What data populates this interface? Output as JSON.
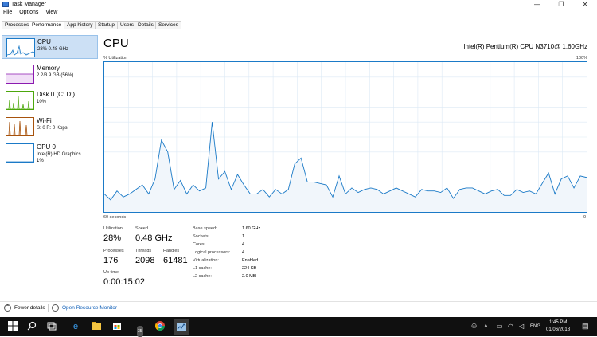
{
  "window": {
    "title": "Task Manager",
    "minimize": "—",
    "maximize": "❐",
    "close": "✕"
  },
  "menu": [
    "File",
    "Options",
    "View"
  ],
  "tabs": [
    "Processes",
    "Performance",
    "App history",
    "Startup",
    "Users",
    "Details",
    "Services"
  ],
  "active_tab": "Performance",
  "sidebar": [
    {
      "name": "CPU",
      "sub": "28%  0.48 GHz",
      "sub2": "",
      "color": "#1b7ac7"
    },
    {
      "name": "Memory",
      "sub": "2.2/3.9 GB (56%)",
      "sub2": "",
      "color": "#8b1ab0"
    },
    {
      "name": "Disk 0 (C: D:)",
      "sub": "10%",
      "sub2": "",
      "color": "#4ca70c"
    },
    {
      "name": "Wi-Fi",
      "sub": "S: 0  R: 0 Kbps",
      "sub2": "",
      "color": "#a7520c"
    },
    {
      "name": "GPU 0",
      "sub": "Intel(R) HD Graphics",
      "sub2": "1%",
      "color": "#1b7ac7"
    }
  ],
  "main": {
    "title": "CPU",
    "model": "Intel(R) Pentium(R) CPU N3710@ 1.60GHz",
    "util_label": "% Utilization",
    "max_label": "100%",
    "time_label": "60 seconds",
    "min_label": "0"
  },
  "stats": {
    "utilization_label": "Utilization",
    "utilization": "28%",
    "speed_label": "Speed",
    "speed": "0.48 GHz",
    "processes_label": "Processes",
    "processes": "176",
    "threads_label": "Threads",
    "threads": "2098",
    "handles_label": "Handles",
    "handles": "61481",
    "uptime_label": "Up time",
    "uptime": "0:00:15:02"
  },
  "specs": [
    {
      "k": "Base speed:",
      "v": "1.60 GHz"
    },
    {
      "k": "Sockets:",
      "v": "1"
    },
    {
      "k": "Cores:",
      "v": "4"
    },
    {
      "k": "Logical processors:",
      "v": "4"
    },
    {
      "k": "Virtualization:",
      "v": "Enabled"
    },
    {
      "k": "L1 cache:",
      "v": "224 KB"
    },
    {
      "k": "L2 cache:",
      "v": "2.0 MB"
    }
  ],
  "footer": {
    "fewer": "Fewer details",
    "monitor": "Open Resource Monitor"
  },
  "cpu_history": [
    12,
    8,
    14,
    10,
    12,
    15,
    18,
    12,
    22,
    48,
    40,
    15,
    21,
    12,
    18,
    14,
    16,
    60,
    22,
    27,
    15,
    25,
    18,
    12,
    12,
    15,
    10,
    15,
    12,
    15,
    32,
    36,
    20,
    20,
    19,
    18,
    10,
    24,
    12,
    16,
    13,
    15,
    16,
    15,
    12,
    14,
    16,
    14,
    12,
    10,
    15,
    14,
    14,
    13,
    16,
    9,
    15,
    16,
    16,
    14,
    12,
    14,
    15,
    11,
    11,
    15,
    13,
    14,
    12,
    19,
    26,
    12,
    22,
    24,
    16,
    24,
    23
  ],
  "taskbar": {
    "badge": "35",
    "lang": "ENG",
    "time": "1:45 PM",
    "date": "01/06/2018"
  }
}
